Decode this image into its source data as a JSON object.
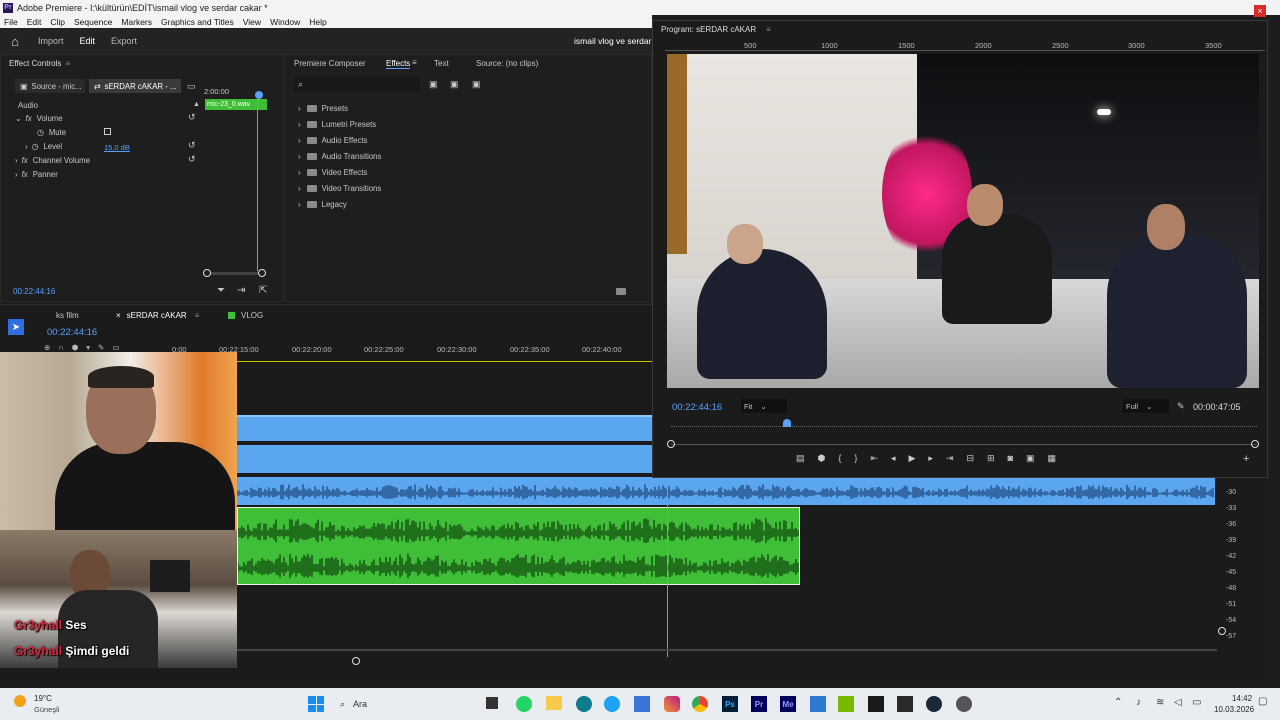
{
  "app": {
    "title": "Adobe Premiere - I:\\kültürün\\EDİT\\ismail vlog ve serdar cakar *",
    "logo_text": "Pr",
    "close_symbol": "×"
  },
  "menu": [
    "File",
    "Edit",
    "Clip",
    "Sequence",
    "Markers",
    "Graphics and Titles",
    "View",
    "Window",
    "Help"
  ],
  "workspace": {
    "tabs": [
      "Import",
      "Edit",
      "Export"
    ],
    "active": "Edit",
    "project_name": "ismail vlog ve serdar"
  },
  "effect_controls": {
    "title": "Effect Controls",
    "source_tab": "Source - mic...",
    "sequence_tab": "sERDAR cAKAR - ...",
    "timecode_top": "2:00:00",
    "clip_label": "mic-23_0.wav",
    "section": "Audio",
    "items": [
      {
        "label": "Volume",
        "expanded": true
      },
      {
        "label": "Mute"
      },
      {
        "label": "Level",
        "value": "15,0 dB"
      },
      {
        "label": "Channel Volume"
      },
      {
        "label": "Panner"
      }
    ],
    "timecode_bottom": "00:22:44:16"
  },
  "effects_panel": {
    "tabs": [
      "Premiere Composer",
      "Effects",
      "Text",
      "Source: (no clips)"
    ],
    "active": "Effects",
    "search_placeholder": "",
    "folders": [
      "Presets",
      "Lumetri Presets",
      "Audio Effects",
      "Audio Transitions",
      "Video Effects",
      "Video Transitions",
      "Legacy"
    ]
  },
  "timeline": {
    "tabs": [
      "ks film",
      "sERDAR cAKAR",
      "VLOG"
    ],
    "active": "sERDAR cAKAR",
    "timecode": "00:22:44:16",
    "ruler": [
      "0:00",
      "00:22:15:00",
      "00:22:20:00",
      "00:22:25:00",
      "00:22:30:00",
      "00:22:35:00",
      "00:22:40:00"
    ],
    "meter_labels": [
      "-30",
      "-33",
      "-36",
      "-39",
      "-42",
      "-45",
      "-48",
      "-51",
      "-54",
      "-57"
    ]
  },
  "program_monitor": {
    "title": "Program: sERDAR cAKAR",
    "ruler": [
      "500",
      "1000",
      "1500",
      "2000",
      "2500",
      "3000",
      "3500"
    ],
    "timecode": "00:22:44:16",
    "fit": "Fit",
    "quality": "Full",
    "duration": "00:00:47:05"
  },
  "webcam": {
    "captions": [
      {
        "name": "Gr3yhall",
        "text": "Ses"
      },
      {
        "name": "Gr3yhall",
        "text": "Şimdi geldi"
      }
    ]
  },
  "taskbar": {
    "weather_temp": "19°C",
    "weather_desc": "Güneşli",
    "search_placeholder": "Ara",
    "time": "14:42",
    "date": "10.03.2026"
  },
  "colors": {
    "accent_blue": "#5aa0ff",
    "audio_green": "#3fbf37",
    "track_blue": "#5aa7ef",
    "caption_red": "#e0263b"
  }
}
